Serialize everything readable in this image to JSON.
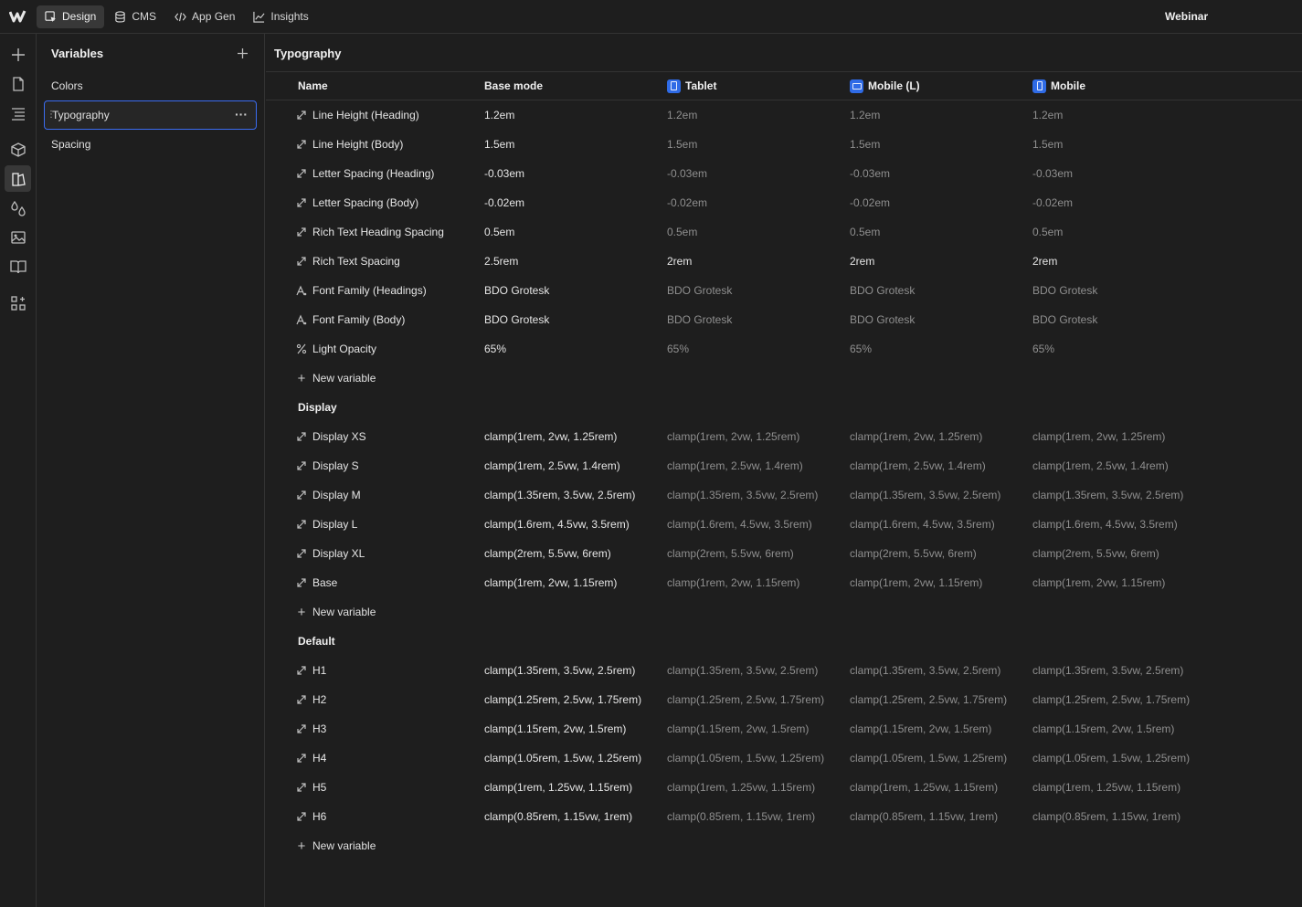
{
  "topbar": {
    "tabs": [
      {
        "label": "Design",
        "icon": "design-cursor-icon",
        "active": true
      },
      {
        "label": "CMS",
        "icon": "database-icon",
        "active": false
      },
      {
        "label": "App Gen",
        "icon": "code-icon",
        "active": false
      },
      {
        "label": "Insights",
        "icon": "chart-line-icon",
        "active": false
      }
    ],
    "project_name": "Webinar"
  },
  "rail": {
    "icons": [
      "add-icon",
      "page-icon",
      "navigator-icon",
      "components-icon",
      "variables-icon",
      "styles-icon",
      "assets-icon",
      "library-icon",
      "apps-icon"
    ],
    "active": "variables-icon"
  },
  "panel": {
    "title": "Variables",
    "collections": [
      {
        "label": "Colors",
        "selected": false
      },
      {
        "label": "Typography",
        "selected": true
      },
      {
        "label": "Spacing",
        "selected": false
      }
    ],
    "more_label": "···"
  },
  "main": {
    "title": "Typography",
    "columns": {
      "name": "Name",
      "base": "Base mode",
      "tablet": "Tablet",
      "mobile_l": "Mobile (L)",
      "mobile": "Mobile"
    },
    "new_variable_label": "New variable",
    "groups": [
      {
        "label": "",
        "rows": [
          {
            "icon": "size-icon",
            "name": "Line Height (Heading)",
            "base": "1.2em",
            "tablet": "1.2em",
            "mobile_l": "1.2em",
            "mobile": "1.2em",
            "override": false
          },
          {
            "icon": "size-icon",
            "name": "Line Height (Body)",
            "base": "1.5em",
            "tablet": "1.5em",
            "mobile_l": "1.5em",
            "mobile": "1.5em",
            "override": false
          },
          {
            "icon": "size-icon",
            "name": "Letter Spacing (Heading)",
            "base": "-0.03em",
            "tablet": "-0.03em",
            "mobile_l": "-0.03em",
            "mobile": "-0.03em",
            "override": false
          },
          {
            "icon": "size-icon",
            "name": "Letter Spacing (Body)",
            "base": "-0.02em",
            "tablet": "-0.02em",
            "mobile_l": "-0.02em",
            "mobile": "-0.02em",
            "override": false
          },
          {
            "icon": "size-icon",
            "name": "Rich Text Heading Spacing",
            "base": "0.5em",
            "tablet": "0.5em",
            "mobile_l": "0.5em",
            "mobile": "0.5em",
            "override": false
          },
          {
            "icon": "size-icon",
            "name": "Rich Text Spacing",
            "base": "2.5rem",
            "tablet": "2rem",
            "mobile_l": "2rem",
            "mobile": "2rem",
            "override": true
          },
          {
            "icon": "font-icon",
            "name": "Font Family (Headings)",
            "base": "BDO Grotesk",
            "tablet": "BDO Grotesk",
            "mobile_l": "BDO Grotesk",
            "mobile": "BDO Grotesk",
            "override": false
          },
          {
            "icon": "font-icon",
            "name": "Font Family (Body)",
            "base": "BDO Grotesk",
            "tablet": "BDO Grotesk",
            "mobile_l": "BDO Grotesk",
            "mobile": "BDO Grotesk",
            "override": false
          },
          {
            "icon": "percent-icon",
            "name": "Light Opacity",
            "base": "65%",
            "tablet": "65%",
            "mobile_l": "65%",
            "mobile": "65%",
            "override": false
          }
        ]
      },
      {
        "label": "Display",
        "rows": [
          {
            "icon": "size-icon",
            "name": "Display XS",
            "base": "clamp(1rem, 2vw, 1.25rem)",
            "tablet": "clamp(1rem, 2vw, 1.25rem)",
            "mobile_l": "clamp(1rem, 2vw, 1.25rem)",
            "mobile": "clamp(1rem, 2vw, 1.25rem)",
            "override": false
          },
          {
            "icon": "size-icon",
            "name": "Display S",
            "base": "clamp(1rem, 2.5vw, 1.4rem)",
            "tablet": "clamp(1rem, 2.5vw, 1.4rem)",
            "mobile_l": "clamp(1rem, 2.5vw, 1.4rem)",
            "mobile": "clamp(1rem, 2.5vw, 1.4rem)",
            "override": false
          },
          {
            "icon": "size-icon",
            "name": "Display M",
            "base": "clamp(1.35rem, 3.5vw, 2.5rem)",
            "tablet": "clamp(1.35rem, 3.5vw, 2.5rem)",
            "mobile_l": "clamp(1.35rem, 3.5vw, 2.5rem)",
            "mobile": "clamp(1.35rem, 3.5vw, 2.5rem)",
            "override": false
          },
          {
            "icon": "size-icon",
            "name": "Display L",
            "base": "clamp(1.6rem, 4.5vw, 3.5rem)",
            "tablet": "clamp(1.6rem, 4.5vw, 3.5rem)",
            "mobile_l": "clamp(1.6rem, 4.5vw, 3.5rem)",
            "mobile": "clamp(1.6rem, 4.5vw, 3.5rem)",
            "override": false
          },
          {
            "icon": "size-icon",
            "name": "Display XL",
            "base": "clamp(2rem, 5.5vw, 6rem)",
            "tablet": "clamp(2rem, 5.5vw, 6rem)",
            "mobile_l": "clamp(2rem, 5.5vw, 6rem)",
            "mobile": "clamp(2rem, 5.5vw, 6rem)",
            "override": false
          },
          {
            "icon": "size-icon",
            "name": "Base",
            "base": "clamp(1rem, 2vw, 1.15rem)",
            "tablet": "clamp(1rem, 2vw, 1.15rem)",
            "mobile_l": "clamp(1rem, 2vw, 1.15rem)",
            "mobile": "clamp(1rem, 2vw, 1.15rem)",
            "override": false
          }
        ]
      },
      {
        "label": "Default",
        "rows": [
          {
            "icon": "size-icon",
            "name": "H1",
            "base": "clamp(1.35rem, 3.5vw, 2.5rem)",
            "tablet": "clamp(1.35rem, 3.5vw, 2.5rem)",
            "mobile_l": "clamp(1.35rem, 3.5vw, 2.5rem)",
            "mobile": "clamp(1.35rem, 3.5vw, 2.5rem)",
            "override": false
          },
          {
            "icon": "size-icon",
            "name": "H2",
            "base": "clamp(1.25rem, 2.5vw, 1.75rem)",
            "tablet": "clamp(1.25rem, 2.5vw, 1.75rem)",
            "mobile_l": "clamp(1.25rem, 2.5vw, 1.75rem)",
            "mobile": "clamp(1.25rem, 2.5vw, 1.75rem)",
            "override": false
          },
          {
            "icon": "size-icon",
            "name": "H3",
            "base": "clamp(1.15rem, 2vw, 1.5rem)",
            "tablet": "clamp(1.15rem, 2vw, 1.5rem)",
            "mobile_l": "clamp(1.15rem, 2vw, 1.5rem)",
            "mobile": "clamp(1.15rem, 2vw, 1.5rem)",
            "override": false
          },
          {
            "icon": "size-icon",
            "name": "H4",
            "base": "clamp(1.05rem, 1.5vw, 1.25rem)",
            "tablet": "clamp(1.05rem, 1.5vw, 1.25rem)",
            "mobile_l": "clamp(1.05rem, 1.5vw, 1.25rem)",
            "mobile": "clamp(1.05rem, 1.5vw, 1.25rem)",
            "override": false
          },
          {
            "icon": "size-icon",
            "name": "H5",
            "base": "clamp(1rem, 1.25vw, 1.15rem)",
            "tablet": "clamp(1rem, 1.25vw, 1.15rem)",
            "mobile_l": "clamp(1rem, 1.25vw, 1.15rem)",
            "mobile": "clamp(1rem, 1.25vw, 1.15rem)",
            "override": false
          },
          {
            "icon": "size-icon",
            "name": "H6",
            "base": "clamp(0.85rem, 1.15vw, 1rem)",
            "tablet": "clamp(0.85rem, 1.15vw, 1rem)",
            "mobile_l": "clamp(0.85rem, 1.15vw, 1rem)",
            "mobile": "clamp(0.85rem, 1.15vw, 1rem)",
            "override": false
          }
        ]
      }
    ]
  },
  "colors": {
    "accent": "#3b6cf0",
    "breakpoint_icon": "#2f6be6",
    "inherited_value": "#8f8f8f",
    "own_value": "#e6e6e6"
  }
}
